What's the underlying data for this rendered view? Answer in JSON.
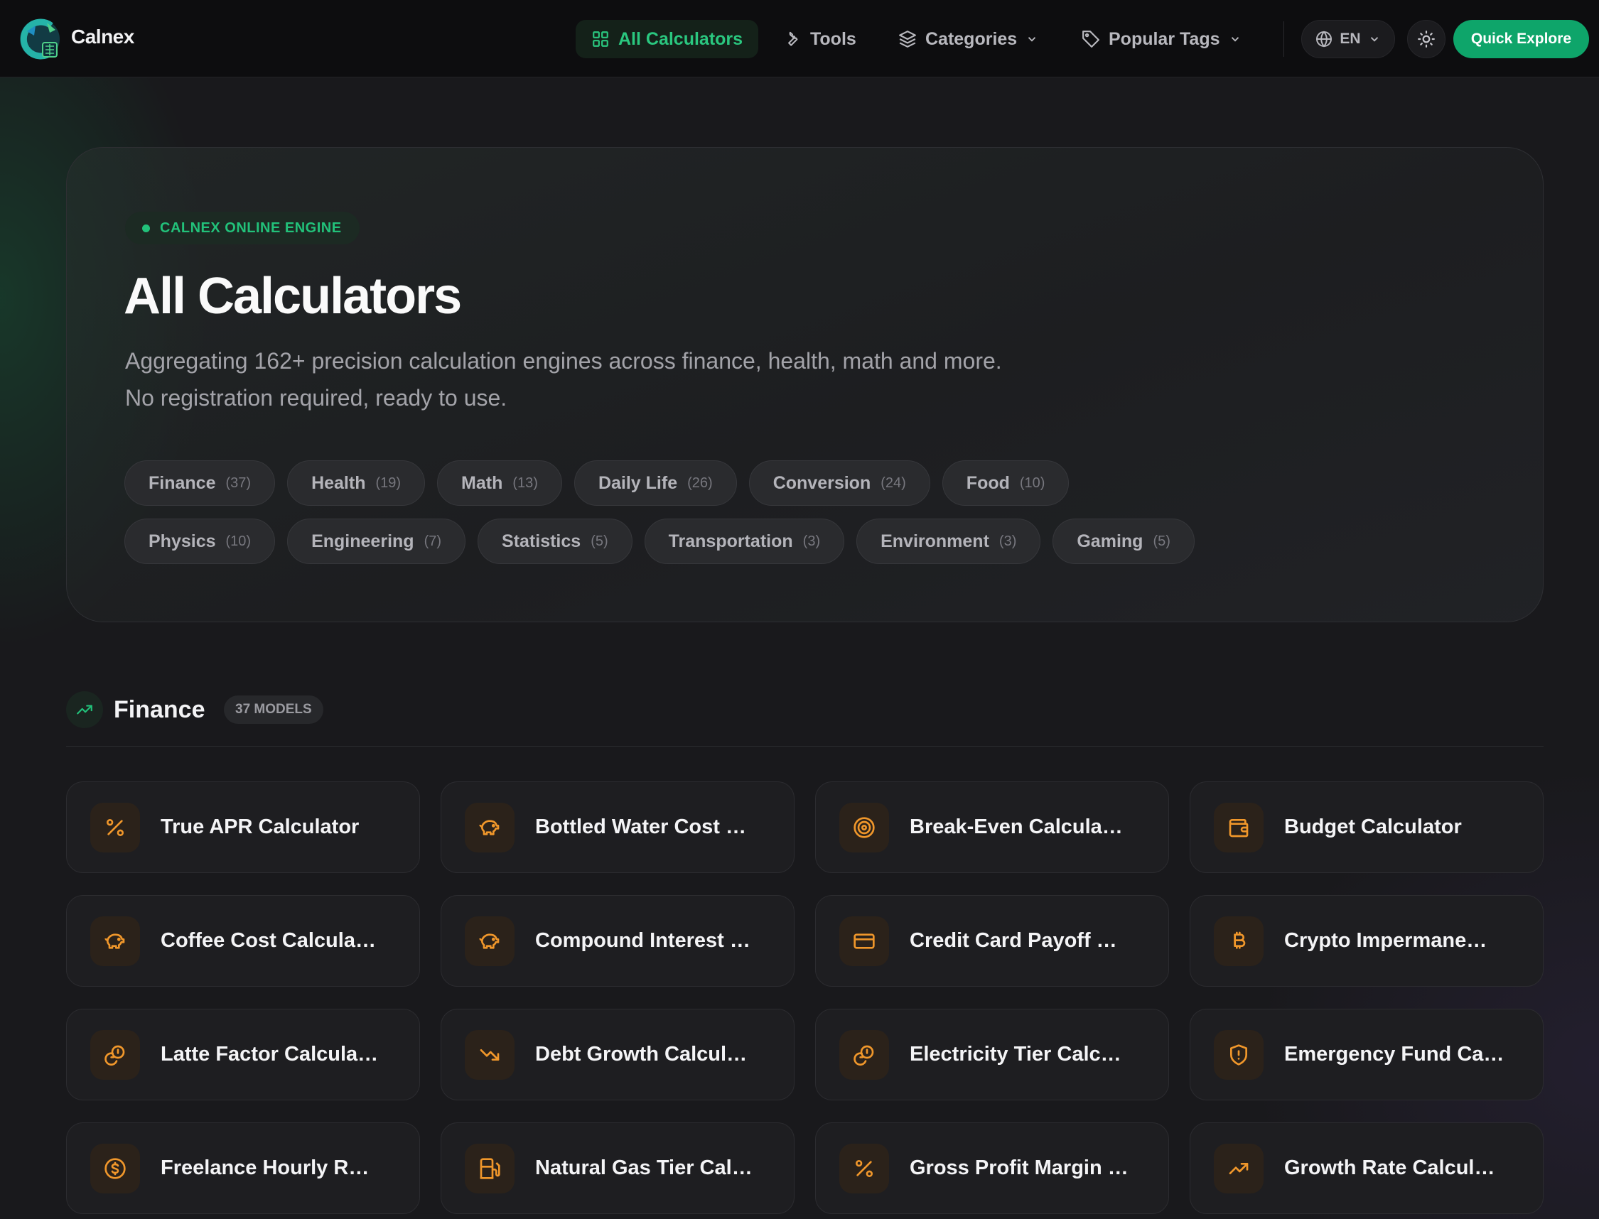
{
  "nav": {
    "brand": "Calnex",
    "items": [
      {
        "label": "All Calculators",
        "icon": "grid-icon",
        "active": true
      },
      {
        "label": "Tools",
        "icon": "wrench-icon"
      },
      {
        "label": "Categories",
        "icon": "layers-icon"
      },
      {
        "label": "Popular Tags",
        "icon": "tag-icon"
      }
    ],
    "lang": "EN",
    "cta": "Quick Explore"
  },
  "hero": {
    "badge": "CALNEX ONLINE ENGINE",
    "title": "All Calculators",
    "desc_line1": "Aggregating 162+ precision calculation engines across finance, health, math and more.",
    "desc_line2": "No registration required, ready to use.",
    "chips_row1": [
      {
        "label": "Finance",
        "count": "(37)"
      },
      {
        "label": "Health",
        "count": "(19)"
      },
      {
        "label": "Math",
        "count": "(13)"
      },
      {
        "label": "Daily Life",
        "count": "(26)"
      },
      {
        "label": "Conversion",
        "count": "(24)"
      },
      {
        "label": "Food",
        "count": "(10)"
      }
    ],
    "chips_row2": [
      {
        "label": "Physics",
        "count": "(10)"
      },
      {
        "label": "Engineering",
        "count": "(7)"
      },
      {
        "label": "Statistics",
        "count": "(5)"
      },
      {
        "label": "Transportation",
        "count": "(3)"
      },
      {
        "label": "Environment",
        "count": "(3)"
      },
      {
        "label": "Gaming",
        "count": "(5)"
      }
    ]
  },
  "section": {
    "title": "Finance",
    "badge": "37 MODELS",
    "cards": [
      {
        "title": "True APR Calculator",
        "icon": "percent-icon"
      },
      {
        "title": "Bottled Water Cost …",
        "icon": "piggy-bank-icon"
      },
      {
        "title": "Break-Even Calcula…",
        "icon": "target-icon"
      },
      {
        "title": "Budget Calculator",
        "icon": "wallet-icon"
      },
      {
        "title": "Coffee Cost Calcula…",
        "icon": "piggy-bank-icon"
      },
      {
        "title": "Compound Interest …",
        "icon": "piggy-bank-icon"
      },
      {
        "title": "Credit Card Payoff …",
        "icon": "credit-card-icon"
      },
      {
        "title": "Crypto Impermane…",
        "icon": "bitcoin-icon"
      },
      {
        "title": "Latte Factor Calcula…",
        "icon": "coins-icon"
      },
      {
        "title": "Debt Growth Calcul…",
        "icon": "trending-down-icon"
      },
      {
        "title": "Electricity Tier Calc…",
        "icon": "coins-icon"
      },
      {
        "title": "Emergency Fund Ca…",
        "icon": "shield-alert-icon"
      },
      {
        "title": "Freelance Hourly R…",
        "icon": "dollar-circle-icon"
      },
      {
        "title": "Natural Gas Tier Cal…",
        "icon": "fuel-icon"
      },
      {
        "title": "Gross Profit Margin …",
        "icon": "percent-icon"
      },
      {
        "title": "Growth Rate Calcul…",
        "icon": "trending-up-icon"
      }
    ]
  },
  "colors": {
    "accent": "#22c17a",
    "cta": "#0ea56a",
    "icon_orange": "#f0972b",
    "background": "#19191c"
  }
}
